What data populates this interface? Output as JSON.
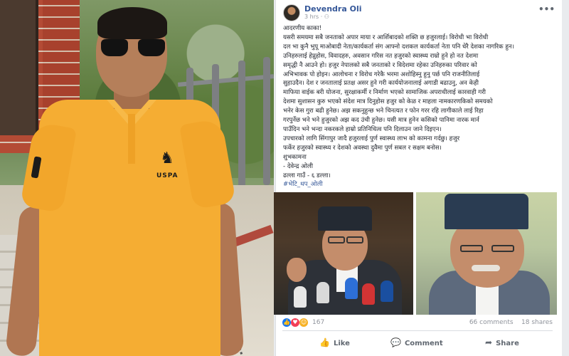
{
  "post": {
    "author": "Devendra Oli",
    "time": "3 hrs ·",
    "more": "•••",
    "body": [
      "आदरणीय काका!",
      "यसरी समयमा सबै जनताको अपार माया र आर्शिबादको शक्ति छ हजुरलाई। विरोधी भा विरोधी",
      "दल भा कुनै भुपू माओबादी नेता/कार्यकर्ता संग आफ्नो दशकल कार्यकर्ता नेता पनि धेरै देशका नागरिक हुन।",
      "उनिहरुलाई हेप्नुहोस, विवादहरु, अवसान गरिस नत हजुरको स्वास्थ्य राम्रो हुने हो नत देशमा",
      "समृद्धी नै आउने हो। हजुर नेपालको सबै जनताको र विदेशमा रहेका उनिहरुका परिवार को",
      "अभिभावक पो होइन। आलोचना र विरोध गरेकै भरमा अशोहिस्नु हुनु पर्छ पनि राजनीतिलाई",
      "सुहाउदैन। देश र जनतालाई प्रतक्ष असर हुने गरी कार्ययोजनालाई अगाडी बढाउनु, अन केही",
      "माफिया वाईक बरी योजना, सुरक्षाकर्मी र निर्माण भएको सामाजिक अपराधीलाई कारवाही गरी",
      "देशमा सुशासन कुरु भएको संदेश मात्र दिनुहोस हजुर को केळ र माहला नामकारणकिको समयको",
      "भनेर केस गुरा बढी हुनेछ। अझ सकनुहुन्छ भने चिनत्यत र फोन गरर रहि लागीकाले लाई रिहा",
      "गरपुर्नेछ भने भने हुजुरको अझ कद उंची हुनेछ। यसी मात्र हुनेन कसिको पानिमा नारक मार्न",
      "पाउँदिन भने भन्दा नकरकले हाम्रो प्रतिनिधित्व पनि दिलाउन जाने दिइएन।",
      "उपचारको लागि सिंगापुर जादै हजुरलाई पुर्ण स्वास्थ्य लाभ को कामना गर्दछु। हजुर",
      "फर्केर हजुरको स्वास्थ्य र देशको अवस्था दुवैमा पुर्ण सबल र सक्षम बनोस।",
      "शुभकामना",
      "- देवेन्द्र ओली",
      "ढल्ला गाउँ - ६ डल्ला।"
    ],
    "hashtags": "#भेटि_थप_ओली",
    "reaction_count": "167",
    "comments": "66 comments",
    "shares": "18 shares",
    "actions": {
      "like": "Like",
      "comment": "Comment",
      "share": "Share"
    },
    "reaction_icons": [
      "like-reaction-icon",
      "love-reaction-icon",
      "haha-reaction-icon"
    ],
    "colors": {
      "link": "#365899",
      "like": "#1877f2",
      "love": "#f33e58",
      "haha": "#f7b125",
      "shirt": "#f5ad33"
    }
  },
  "photo_overlay": {
    "shirt_logo": "USPA"
  }
}
